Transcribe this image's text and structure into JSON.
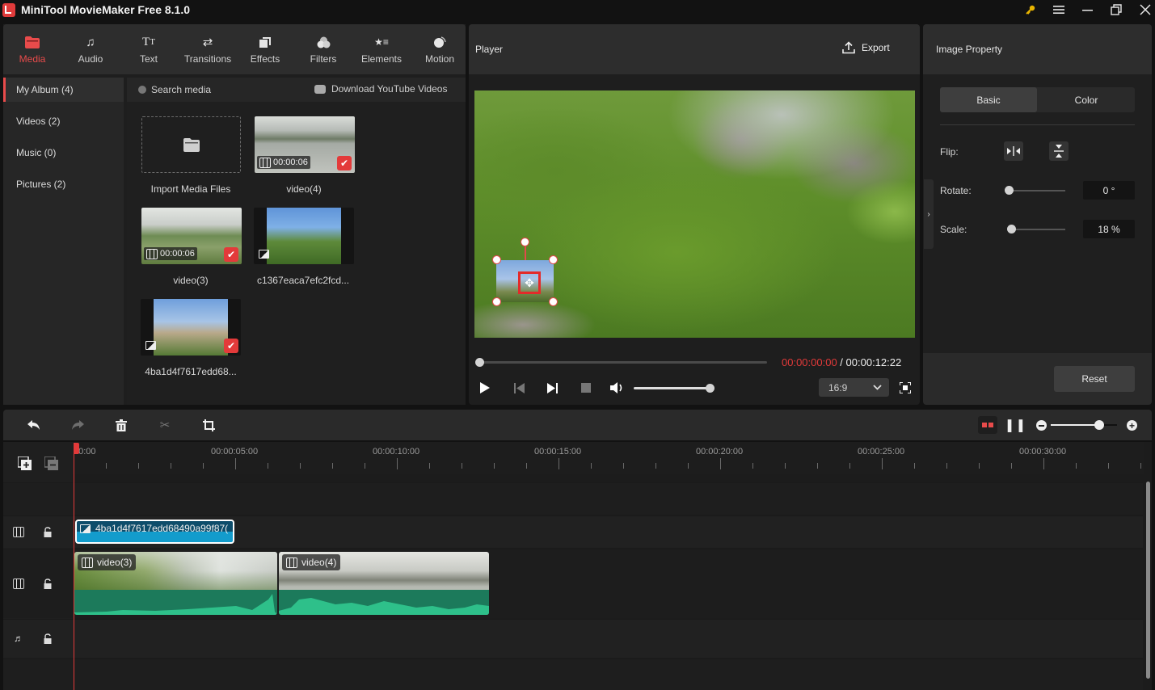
{
  "app": {
    "title": "MiniTool MovieMaker Free 8.1.0",
    "window_controls": [
      "key-icon",
      "menu-icon",
      "minimize-icon",
      "restore-icon",
      "close-icon"
    ],
    "accent_color": "#e84b4b"
  },
  "top_nav": {
    "items": [
      {
        "label": "Media",
        "icon": "folder-icon",
        "active": true
      },
      {
        "label": "Audio",
        "icon": "music-note-icon"
      },
      {
        "label": "Text",
        "icon": "text-icon"
      },
      {
        "label": "Transitions",
        "icon": "transitions-icon"
      },
      {
        "label": "Effects",
        "icon": "effects-icon"
      },
      {
        "label": "Filters",
        "icon": "filters-icon"
      },
      {
        "label": "Elements",
        "icon": "elements-icon"
      },
      {
        "label": "Motion",
        "icon": "motion-icon"
      }
    ]
  },
  "album": {
    "items": [
      {
        "label": "My Album (4)",
        "active": true
      },
      {
        "label": "Videos (2)"
      },
      {
        "label": "Music (0)"
      },
      {
        "label": "Pictures (2)"
      }
    ]
  },
  "media": {
    "search_placeholder": "Search media",
    "download_label": "Download YouTube Videos",
    "import_label": "Import Media Files",
    "items": [
      {
        "name": "video(4)",
        "type": "video",
        "duration": "00:00:06",
        "added": true
      },
      {
        "name": "video(3)",
        "type": "video",
        "duration": "00:00:06",
        "added": true
      },
      {
        "name": "c1367eaca7efc2fcd...",
        "type": "image",
        "added": false
      },
      {
        "name": "4ba1d4f7617edd68...",
        "type": "image",
        "added": true
      }
    ]
  },
  "player": {
    "title": "Player",
    "export_label": "Export",
    "current_time": "00:00:00:00",
    "separator": " / ",
    "total_time": "00:00:12:22",
    "progress": 0.0,
    "volume": 1.0,
    "aspect_ratio": "16:9",
    "current_time_color": "#e23a3a"
  },
  "property": {
    "title": "Image Property",
    "tabs": [
      {
        "label": "Basic",
        "active": true
      },
      {
        "label": "Color"
      }
    ],
    "flip_label": "Flip:",
    "rotate_label": "Rotate:",
    "rotate_value": "0 °",
    "rotate_fraction": 0.0,
    "scale_label": "Scale:",
    "scale_value": "18 %",
    "scale_fraction": 0.05,
    "reset_label": "Reset"
  },
  "timeline": {
    "zoom_level": 0.73,
    "ruler_labels": [
      "00:00",
      "00:00:05:00",
      "00:00:10:00",
      "00:00:15:00",
      "00:00:20:00",
      "00:00:25:00",
      "00:00:30:00"
    ],
    "clips": {
      "image": {
        "label": "4ba1d4f7617edd68490a99f87("
      },
      "video": [
        {
          "label": "video(3)"
        },
        {
          "label": "video(4)"
        }
      ]
    }
  }
}
